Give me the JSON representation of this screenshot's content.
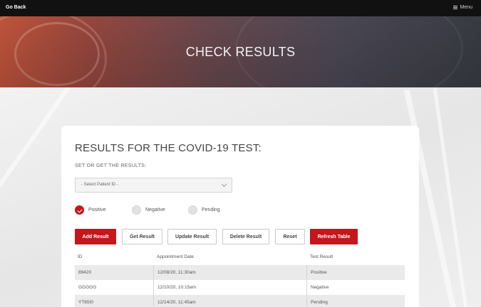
{
  "topbar": {
    "go_back": "Go Back",
    "menu": "Menu"
  },
  "hero": {
    "title": "CHECK RESULTS"
  },
  "card": {
    "title": "RESULTS FOR THE COVID-19 TEST:",
    "subtitle": "SET OR GET THE RESULTS:",
    "select_value": "- Select Patient ID -",
    "radios": [
      {
        "label": "Positive",
        "checked": true
      },
      {
        "label": "Negative",
        "checked": false
      },
      {
        "label": "Pending",
        "checked": false
      }
    ],
    "buttons": {
      "add": "Add Result",
      "get": "Get Result",
      "update": "Update Result",
      "delete": "Delete Result",
      "reset": "Reset",
      "refresh": "Refresh Table"
    },
    "table": {
      "headers": [
        "ID",
        "Appointment Date",
        "Test Result"
      ],
      "rows": [
        [
          "89420",
          "12/08/20, 11:30am",
          "Positive"
        ],
        [
          "GGGGG",
          "12/10/20, 10:15am",
          "Negative"
        ],
        [
          "YT65I0",
          "12/14/20, 11:45am",
          "Pending"
        ]
      ]
    }
  },
  "colors": {
    "accent": "#c4161c",
    "topbar": "#111111"
  }
}
